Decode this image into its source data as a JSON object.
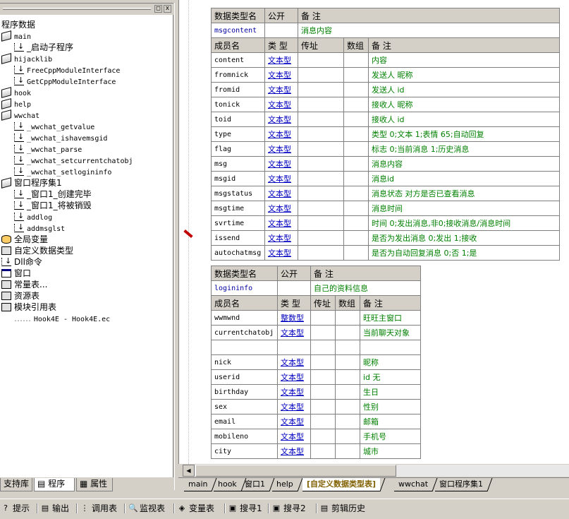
{
  "tree": {
    "root": "程序数据",
    "items": [
      {
        "label": "main",
        "mono": true
      },
      {
        "label": "_启动子程序",
        "mono": false
      },
      {
        "label": "hijacklib",
        "mono": true
      },
      {
        "label": "FreeCppModuleInterface",
        "mono": true
      },
      {
        "label": "GetCppModuleInterface",
        "mono": true
      },
      {
        "label": "hook",
        "mono": true
      },
      {
        "label": "help",
        "mono": true
      },
      {
        "label": "wwchat",
        "mono": true
      },
      {
        "label": "_wwchat_getvalue",
        "mono": true
      },
      {
        "label": "_wwchat_ishavemsgid",
        "mono": true
      },
      {
        "label": "_wwchat_parse",
        "mono": true
      },
      {
        "label": "_wwchat_setcurrentchatobj",
        "mono": true
      },
      {
        "label": "_wwchat_setlogininfo",
        "mono": true
      },
      {
        "label": "窗口程序集1",
        "mono": false
      },
      {
        "label": "_窗口1_创建完毕",
        "mono": false
      },
      {
        "label": "_窗口1_将被销毁",
        "mono": false
      },
      {
        "label": "addlog",
        "mono": true
      },
      {
        "label": "addmsglst",
        "mono": true
      },
      {
        "label": "全局变量",
        "mono": false
      },
      {
        "label": "自定义数据类型",
        "mono": false
      },
      {
        "label": "Dll命令",
        "mono": false
      },
      {
        "label": "窗口",
        "mono": false
      },
      {
        "label": "常量表...",
        "mono": false
      },
      {
        "label": "资源表",
        "mono": false
      },
      {
        "label": "模块引用表",
        "mono": false
      },
      {
        "label": "Hook4E - Hook4E.ec",
        "mono": true
      }
    ]
  },
  "left_tabs": [
    "支持库",
    "程序",
    "属性"
  ],
  "window_buttons": {
    "restore": "□",
    "close": "x"
  },
  "table_headers": {
    "type_name": "数据类型名",
    "public": "公开",
    "note": "备 注",
    "member": "成员名",
    "type": "类 型",
    "byref": "传址",
    "array": "数组"
  },
  "types": [
    {
      "name": "msgcontent",
      "note": "消息内容",
      "members": [
        {
          "name": "content",
          "type": "文本型",
          "note": "内容"
        },
        {
          "name": "fromnick",
          "type": "文本型",
          "note": "发送人 昵称"
        },
        {
          "name": "fromid",
          "type": "文本型",
          "note": "发送人 id"
        },
        {
          "name": "tonick",
          "type": "文本型",
          "note": "接收人 昵称"
        },
        {
          "name": "toid",
          "type": "文本型",
          "note": "接收人 id"
        },
        {
          "name": "type",
          "type": "文本型",
          "note": "类型 0;文本 1;表情 65;自动回复"
        },
        {
          "name": "flag",
          "type": "文本型",
          "note": "标志 0;当前消息 1;历史消息"
        },
        {
          "name": "msg",
          "type": "文本型",
          "note": "消息内容"
        },
        {
          "name": "msgid",
          "type": "文本型",
          "note": "消息id"
        },
        {
          "name": "msgstatus",
          "type": "文本型",
          "note": "消息状态 对方是否已查看消息"
        },
        {
          "name": "msgtime",
          "type": "文本型",
          "note": "消息时间"
        },
        {
          "name": "svrtime",
          "type": "文本型",
          "note": "时间 0;发出消息,非0;接收消息/消息时间"
        },
        {
          "name": "issend",
          "type": "文本型",
          "note": "是否为发出消息 0;发出 1;接收"
        },
        {
          "name": "autochatmsg",
          "type": "文本型",
          "note": "是否为自动回复消息 0;否 1;是"
        }
      ]
    },
    {
      "name": "logininfo",
      "note": "自己的资料信息",
      "members": [
        {
          "name": "wwmwnd",
          "type": "整数型",
          "note": "旺旺主窗口"
        },
        {
          "name": "currentchatobj",
          "type": "文本型",
          "note": "当前聊天对象"
        },
        {
          "name": "",
          "type": "",
          "note": ""
        },
        {
          "name": "nick",
          "type": "文本型",
          "note": "昵称"
        },
        {
          "name": "userid",
          "type": "文本型",
          "note": "id 无"
        },
        {
          "name": "birthday",
          "type": "文本型",
          "note": "生日"
        },
        {
          "name": "sex",
          "type": "文本型",
          "note": "性别"
        },
        {
          "name": "email",
          "type": "文本型",
          "note": "邮箱"
        },
        {
          "name": "mobileno",
          "type": "文本型",
          "note": "手机号"
        },
        {
          "name": "city",
          "type": "文本型",
          "note": "城市"
        }
      ]
    }
  ],
  "editor_tabs": [
    "main",
    "hook",
    "窗口1",
    "help",
    "[自定义数据类型表]",
    "wwchat",
    "窗口程序集1"
  ],
  "bottom_tools": [
    {
      "label": "提示",
      "icon": "?"
    },
    {
      "label": "输出",
      "icon": "▤"
    },
    {
      "label": "调用表",
      "icon": "⋮"
    },
    {
      "label": "监视表",
      "icon": "🔍"
    },
    {
      "label": "变量表",
      "icon": "◈"
    },
    {
      "label": "搜寻1",
      "icon": "▣"
    },
    {
      "label": "搜寻2",
      "icon": "▣"
    },
    {
      "label": "剪辑历史",
      "icon": "▤"
    }
  ]
}
